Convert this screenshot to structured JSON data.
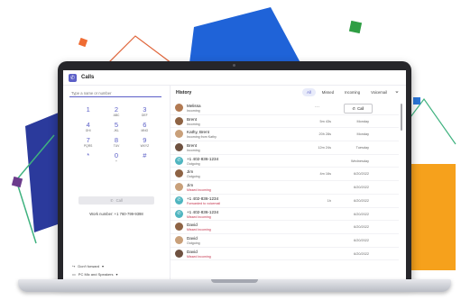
{
  "app": {
    "title": "Calls",
    "icon": "phone-app-icon"
  },
  "dialer": {
    "search_placeholder": "Type a name or number",
    "keys": [
      {
        "digit": "1",
        "letters": ""
      },
      {
        "digit": "2",
        "letters": "ABC"
      },
      {
        "digit": "3",
        "letters": "DEF"
      },
      {
        "digit": "4",
        "letters": "GHI"
      },
      {
        "digit": "5",
        "letters": "JKL"
      },
      {
        "digit": "6",
        "letters": "MNO"
      },
      {
        "digit": "7",
        "letters": "PQRS"
      },
      {
        "digit": "8",
        "letters": "TUV"
      },
      {
        "digit": "9",
        "letters": "WXYZ"
      },
      {
        "digit": "*",
        "letters": ""
      },
      {
        "digit": "0",
        "letters": "+"
      },
      {
        "digit": "#",
        "letters": ""
      }
    ],
    "call_label": "Call",
    "work_number": "Work number: +1 760-799-9398",
    "forward_label": "Don't forward",
    "device_label": "PC Mic and Speakers"
  },
  "history": {
    "title": "History",
    "filters": [
      "All",
      "Missed",
      "Incoming",
      "Voicemail"
    ],
    "active_filter": "All",
    "row_call_label": "Call",
    "rows": [
      {
        "name": "Melissa",
        "detail": "Incoming",
        "missed": false,
        "duration": "",
        "date": "",
        "hover": true,
        "teal": false
      },
      {
        "name": "Brent",
        "detail": "Incoming",
        "missed": false,
        "duration": "5m 43s",
        "date": "Monday",
        "hover": false,
        "teal": false
      },
      {
        "name": "Kathy, Brent",
        "detail": "Incoming from Kathy",
        "missed": false,
        "duration": "20h 28s",
        "date": "Monday",
        "hover": false,
        "teal": false
      },
      {
        "name": "Brent",
        "detail": "Incoming",
        "missed": false,
        "duration": "12m 24s",
        "date": "Tuesday",
        "hover": false,
        "teal": false
      },
      {
        "name": "+1 402-836-1234",
        "detail": "Outgoing",
        "missed": false,
        "duration": "",
        "date": "Wednesday",
        "hover": false,
        "teal": true
      },
      {
        "name": "Jim",
        "detail": "Outgoing",
        "missed": false,
        "duration": "4m 16s",
        "date": "6/20/2022",
        "hover": false,
        "teal": false
      },
      {
        "name": "Jim",
        "detail": "Missed incoming",
        "missed": true,
        "duration": "",
        "date": "6/20/2022",
        "hover": false,
        "teal": false
      },
      {
        "name": "+1 402-836-1234",
        "detail": "Forwarded to voicemail",
        "missed": true,
        "duration": "1h",
        "date": "6/20/2022",
        "hover": false,
        "teal": true
      },
      {
        "name": "+1 402-836-1234",
        "detail": "Missed incoming",
        "missed": true,
        "duration": "",
        "date": "6/20/2022",
        "hover": false,
        "teal": true
      },
      {
        "name": "David",
        "detail": "Missed incoming",
        "missed": true,
        "duration": "",
        "date": "6/20/2022",
        "hover": false,
        "teal": false
      },
      {
        "name": "David",
        "detail": "Outgoing",
        "missed": false,
        "duration": "",
        "date": "6/20/2022",
        "hover": false,
        "teal": false
      },
      {
        "name": "David",
        "detail": "Missed incoming",
        "missed": true,
        "duration": "",
        "date": "6/20/2022",
        "hover": false,
        "teal": false
      }
    ]
  },
  "colors": {
    "accent": "#5b5fc7",
    "missed": "#c4314b",
    "decor_blue": "#1f63d8",
    "decor_orange": "#f6a11c",
    "decor_navy": "#2b3a9c"
  }
}
